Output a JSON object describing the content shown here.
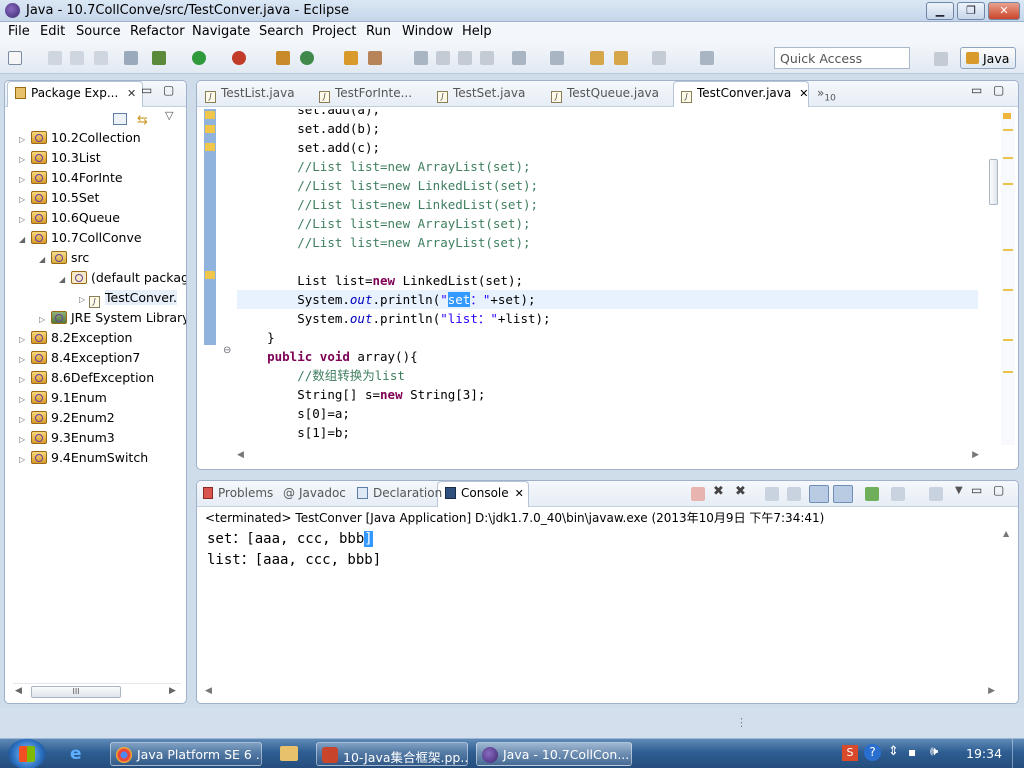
{
  "window": {
    "title": "Java - 10.7CollConve/src/TestConver.java - Eclipse",
    "min_glyph": "▁",
    "max_glyph": "❐",
    "close_glyph": "✕"
  },
  "menu": [
    "File",
    "Edit",
    "Source",
    "Refactor",
    "Navigate",
    "Search",
    "Project",
    "Run",
    "Window",
    "Help"
  ],
  "toolbar": {
    "quick_access_placeholder": "Quick Access",
    "perspective": "Java"
  },
  "package_explorer": {
    "title": "Package Exp...",
    "items": [
      {
        "label": "10.2Collection",
        "expanded": false,
        "level": 0,
        "type": "project"
      },
      {
        "label": "10.3List",
        "expanded": false,
        "level": 0,
        "type": "project"
      },
      {
        "label": "10.4ForInte",
        "expanded": false,
        "level": 0,
        "type": "project"
      },
      {
        "label": "10.5Set",
        "expanded": false,
        "level": 0,
        "type": "project"
      },
      {
        "label": "10.6Queue",
        "expanded": false,
        "level": 0,
        "type": "project"
      },
      {
        "label": "10.7CollConve",
        "expanded": true,
        "level": 0,
        "type": "project"
      },
      {
        "label": "src",
        "expanded": true,
        "level": 1,
        "type": "folder"
      },
      {
        "label": "(default packag",
        "expanded": true,
        "level": 2,
        "type": "package"
      },
      {
        "label": "TestConver.",
        "expanded": false,
        "level": 3,
        "type": "file"
      },
      {
        "label": "JRE System Library",
        "expanded": false,
        "level": 1,
        "type": "library"
      },
      {
        "label": "8.2Exception",
        "expanded": false,
        "level": 0,
        "type": "project"
      },
      {
        "label": "8.4Exception7",
        "expanded": false,
        "level": 0,
        "type": "project"
      },
      {
        "label": "8.6DefException",
        "expanded": false,
        "level": 0,
        "type": "project"
      },
      {
        "label": "9.1Enum",
        "expanded": false,
        "level": 0,
        "type": "project"
      },
      {
        "label": "9.2Enum2",
        "expanded": false,
        "level": 0,
        "type": "project"
      },
      {
        "label": "9.3Enum3",
        "expanded": false,
        "level": 0,
        "type": "project"
      },
      {
        "label": "9.4EnumSwitch",
        "expanded": false,
        "level": 0,
        "type": "project"
      }
    ],
    "hscroll_thumb": "III"
  },
  "editor": {
    "tabs": [
      {
        "label": "TestList.java",
        "active": false
      },
      {
        "label": "TestForInte...",
        "active": false
      },
      {
        "label": "TestSet.java",
        "active": false
      },
      {
        "label": "TestQueue.java",
        "active": false
      },
      {
        "label": "TestConver.java",
        "active": true
      }
    ],
    "overflow_label": "»",
    "overflow_count": "10",
    "lines": [
      {
        "indent": "        ",
        "parts": [
          {
            "t": "set.add(a);",
            "c": ""
          }
        ]
      },
      {
        "indent": "        ",
        "parts": [
          {
            "t": "set.add(b);",
            "c": ""
          }
        ]
      },
      {
        "indent": "        ",
        "parts": [
          {
            "t": "set.add(c);",
            "c": ""
          }
        ]
      },
      {
        "indent": "        ",
        "parts": [
          {
            "t": "//List list=new ArrayList(set);",
            "c": "cm"
          }
        ]
      },
      {
        "indent": "        ",
        "parts": [
          {
            "t": "//List list=new LinkedList(set);",
            "c": "cm"
          }
        ]
      },
      {
        "indent": "        ",
        "parts": [
          {
            "t": "//List list=new LinkedList(set);",
            "c": "cm"
          }
        ]
      },
      {
        "indent": "        ",
        "parts": [
          {
            "t": "//List list=new ArrayList(set);",
            "c": "cm"
          }
        ]
      },
      {
        "indent": "        ",
        "parts": [
          {
            "t": "//List list=new ArrayList(set);",
            "c": "cm"
          }
        ]
      },
      {
        "indent": "",
        "parts": []
      },
      {
        "indent": "        ",
        "parts": [
          {
            "t": "List list=",
            "c": ""
          },
          {
            "t": "new",
            "c": "kw"
          },
          {
            "t": " LinkedList(set);",
            "c": ""
          }
        ]
      },
      {
        "indent": "        ",
        "hl": true,
        "parts": [
          {
            "t": "System.",
            "c": ""
          },
          {
            "t": "out",
            "c": "it"
          },
          {
            "t": ".println(",
            "c": ""
          },
          {
            "t": "\"",
            "c": "st"
          },
          {
            "t": "set",
            "c": "sel"
          },
          {
            "t": "：\"",
            "c": "st"
          },
          {
            "t": "+set);",
            "c": ""
          }
        ]
      },
      {
        "indent": "        ",
        "parts": [
          {
            "t": "System.",
            "c": ""
          },
          {
            "t": "out",
            "c": "it"
          },
          {
            "t": ".println(",
            "c": ""
          },
          {
            "t": "\"list：\"",
            "c": "st"
          },
          {
            "t": "+list);",
            "c": ""
          }
        ]
      },
      {
        "indent": "    ",
        "parts": [
          {
            "t": "}",
            "c": ""
          }
        ]
      },
      {
        "indent": "    ",
        "parts": [
          {
            "t": "public",
            "c": "kw"
          },
          {
            "t": " ",
            "c": ""
          },
          {
            "t": "void",
            "c": "kw"
          },
          {
            "t": " array(){",
            "c": ""
          }
        ]
      },
      {
        "indent": "        ",
        "parts": [
          {
            "t": "//数组转换为list",
            "c": "cm"
          }
        ]
      },
      {
        "indent": "        ",
        "parts": [
          {
            "t": "String[] s=",
            "c": ""
          },
          {
            "t": "new",
            "c": "kw"
          },
          {
            "t": " String[3];",
            "c": ""
          }
        ]
      },
      {
        "indent": "        ",
        "parts": [
          {
            "t": "s[0]=a;",
            "c": ""
          }
        ]
      },
      {
        "indent": "        ",
        "parts": [
          {
            "t": "s[1]=b;",
            "c": ""
          }
        ]
      }
    ]
  },
  "console": {
    "tabs": [
      {
        "label": "Problems",
        "active": false
      },
      {
        "label": "Javadoc",
        "active": false
      },
      {
        "label": "Declaration",
        "active": false
      },
      {
        "label": "Console",
        "active": true
      }
    ],
    "status": "<terminated> TestConver [Java Application] D:\\jdk1.7.0_40\\bin\\javaw.exe (2013年10月9日 下午7:34:41)",
    "output": [
      {
        "text": "set：[aaa, ccc, bbb",
        "tail": "]"
      },
      {
        "text": "list：[aaa, ccc, bbb]",
        "tail": ""
      }
    ]
  },
  "taskbar": {
    "items": [
      {
        "label": "Java Platform SE 6 ..."
      },
      {
        "label": "10-Java集合框架.pp..."
      },
      {
        "label": "Java - 10.7CollCon..."
      }
    ],
    "clock": "19:34"
  }
}
